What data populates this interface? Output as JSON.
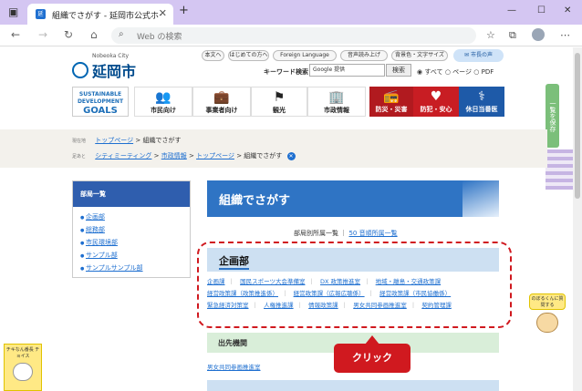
{
  "browser": {
    "tab_title": "組織でさがす - 延岡市公式ホームページ",
    "tab_favicon": "延",
    "address_placeholder": "Web の検索",
    "icons": [
      "back-icon",
      "forward-icon",
      "reload-icon",
      "home-icon",
      "search-icon",
      "favorites-icon",
      "collections-icon",
      "tab-actions-icon",
      "profile-icon",
      "more-icon"
    ]
  },
  "header": {
    "logo_sub": "Nobeoka City",
    "logo_name": "延岡市",
    "util_links": [
      "本文へ",
      "はじめての方へ",
      "Foreign Language",
      "音声読み上げ",
      "背景色・文字サイズ"
    ],
    "voice": "市長の声",
    "keyword_label": "キーワード検索",
    "search_value": "Google 提供",
    "search_button": "検索",
    "radio_all": "すべて",
    "radio_page": "ページ",
    "radio_pdf": "PDF"
  },
  "sdgs": {
    "line1": "SUSTAINABLE",
    "line2": "DEVELOPMENT",
    "line3": "GOALS"
  },
  "nav": {
    "citizens": "市民向け",
    "business": "事業者向け",
    "tourism": "観光",
    "info": "市政情報",
    "disaster": "防災・災害",
    "crime": "防犯・安心",
    "holiday": "休日当番医"
  },
  "side_tab": "一覧を保存",
  "breadcrumbs": {
    "current_label": "現在地",
    "current_link": "トップページ",
    "current_page": "組織でさがす",
    "visited_label": "足あと",
    "trail": [
      "シティミーティング",
      "市政情報",
      "トップページ",
      "組織でさがす"
    ]
  },
  "sidenav": {
    "heading": "部局一覧",
    "items": [
      "企画部",
      "総務部",
      "市民環境部",
      "サンプル部",
      "サンプルサンプル部"
    ]
  },
  "main": {
    "title": "組織でさがす",
    "list_label": "部局別所属一覧",
    "list_link": "50 音順所属一覧",
    "dept_heading": "企画部",
    "dept_links": [
      "企画課",
      "国民スポーツ大会準備室",
      "DX 政策推進室",
      "地域・離島・交通政策課",
      "経営政策課（政策推進係）",
      "経営政策課（広報広聴係）",
      "経営政策課（市民協働係）",
      "緊急経済対策室",
      "人権推進課",
      "情報政策課",
      "男女共同参画推進室",
      "契約管理課"
    ],
    "outer_heading": "出先機関",
    "outer_link": "男女共同参画推進室"
  },
  "callout": "クリック",
  "mascot": {
    "bubble": "のぼるくんに質問する",
    "tiny": "チキなん番長 チョイス"
  }
}
